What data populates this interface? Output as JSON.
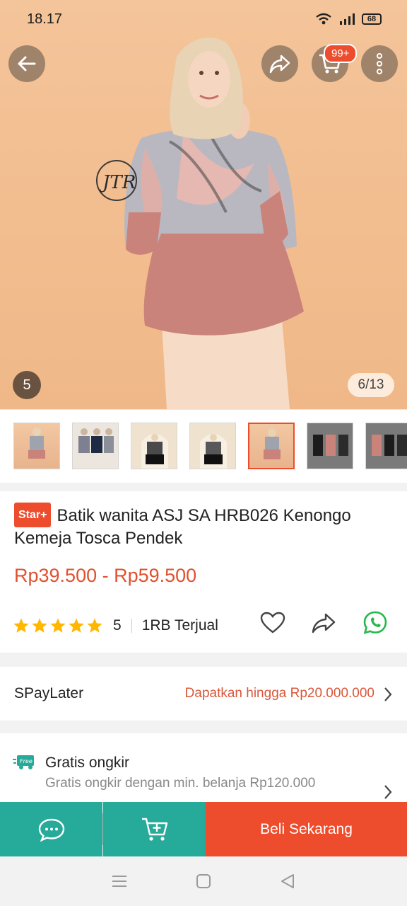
{
  "status": {
    "time": "18.17",
    "battery": "68"
  },
  "header": {
    "cart_badge": "99+"
  },
  "gallery": {
    "current_slide_badge": "5",
    "counter": "6/13",
    "watermark": "JTR"
  },
  "product": {
    "badge": "Star+",
    "title": "Batik wanita ASJ SA HRB026 Kenongo Kemeja Tosca Pendek",
    "price": "Rp39.500 - Rp59.500",
    "rating": "5",
    "sold": "1RB Terjual"
  },
  "spaylater": {
    "label": "SPayLater",
    "value": "Dapatkan hingga Rp20.000.000"
  },
  "shipping": {
    "icon_text": "Free",
    "title": "Gratis ongkir",
    "subtitle": "Gratis ongkir dengan min. belanja Rp120.000"
  },
  "actions": {
    "buy_label": "Beli Sekarang"
  },
  "colors": {
    "accent": "#ee4d2d",
    "teal": "#26aa99",
    "star": "#ffb700",
    "whatsapp": "#25b84c"
  }
}
